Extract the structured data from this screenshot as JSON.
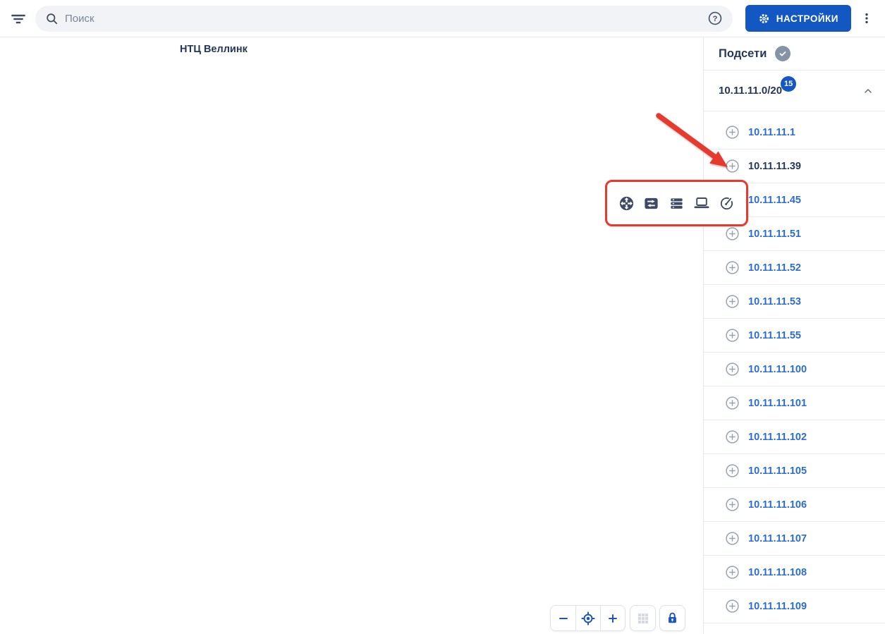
{
  "header": {
    "search_placeholder": "Поиск",
    "settings_label": "НАСТРОЙКИ"
  },
  "canvas": {
    "node_label": "НТЦ Веллинк",
    "zoom_controls": [
      "zoom-out",
      "locate",
      "zoom-in",
      "grid-toggle",
      "lock"
    ]
  },
  "annotation_toolbar": {
    "icons": [
      "router",
      "switch",
      "server",
      "laptop",
      "gauge"
    ]
  },
  "sidebar": {
    "title": "Подсети",
    "subnet": {
      "label": "10.11.11.0/20",
      "count": "15"
    },
    "ips": [
      {
        "label": "10.11.11.1"
      },
      {
        "label": "10.11.11.39",
        "highlighted": true
      },
      {
        "label": "10.11.11.45"
      },
      {
        "label": "10.11.11.51"
      },
      {
        "label": "10.11.11.52"
      },
      {
        "label": "10.11.11.53"
      },
      {
        "label": "10.11.11.55"
      },
      {
        "label": "10.11.11.100"
      },
      {
        "label": "10.11.11.101"
      },
      {
        "label": "10.11.11.102"
      },
      {
        "label": "10.11.11.105"
      },
      {
        "label": "10.11.11.106"
      },
      {
        "label": "10.11.11.107"
      },
      {
        "label": "10.11.11.108"
      },
      {
        "label": "10.11.11.109"
      }
    ]
  },
  "colors": {
    "accent_blue": "#1257c2",
    "link_blue": "#2b6cd4",
    "dark_navy": "#253858",
    "icon_slate": "#3e4a63",
    "muted_gray": "#9aa3b0",
    "annotation_red": "#e63a2e"
  }
}
